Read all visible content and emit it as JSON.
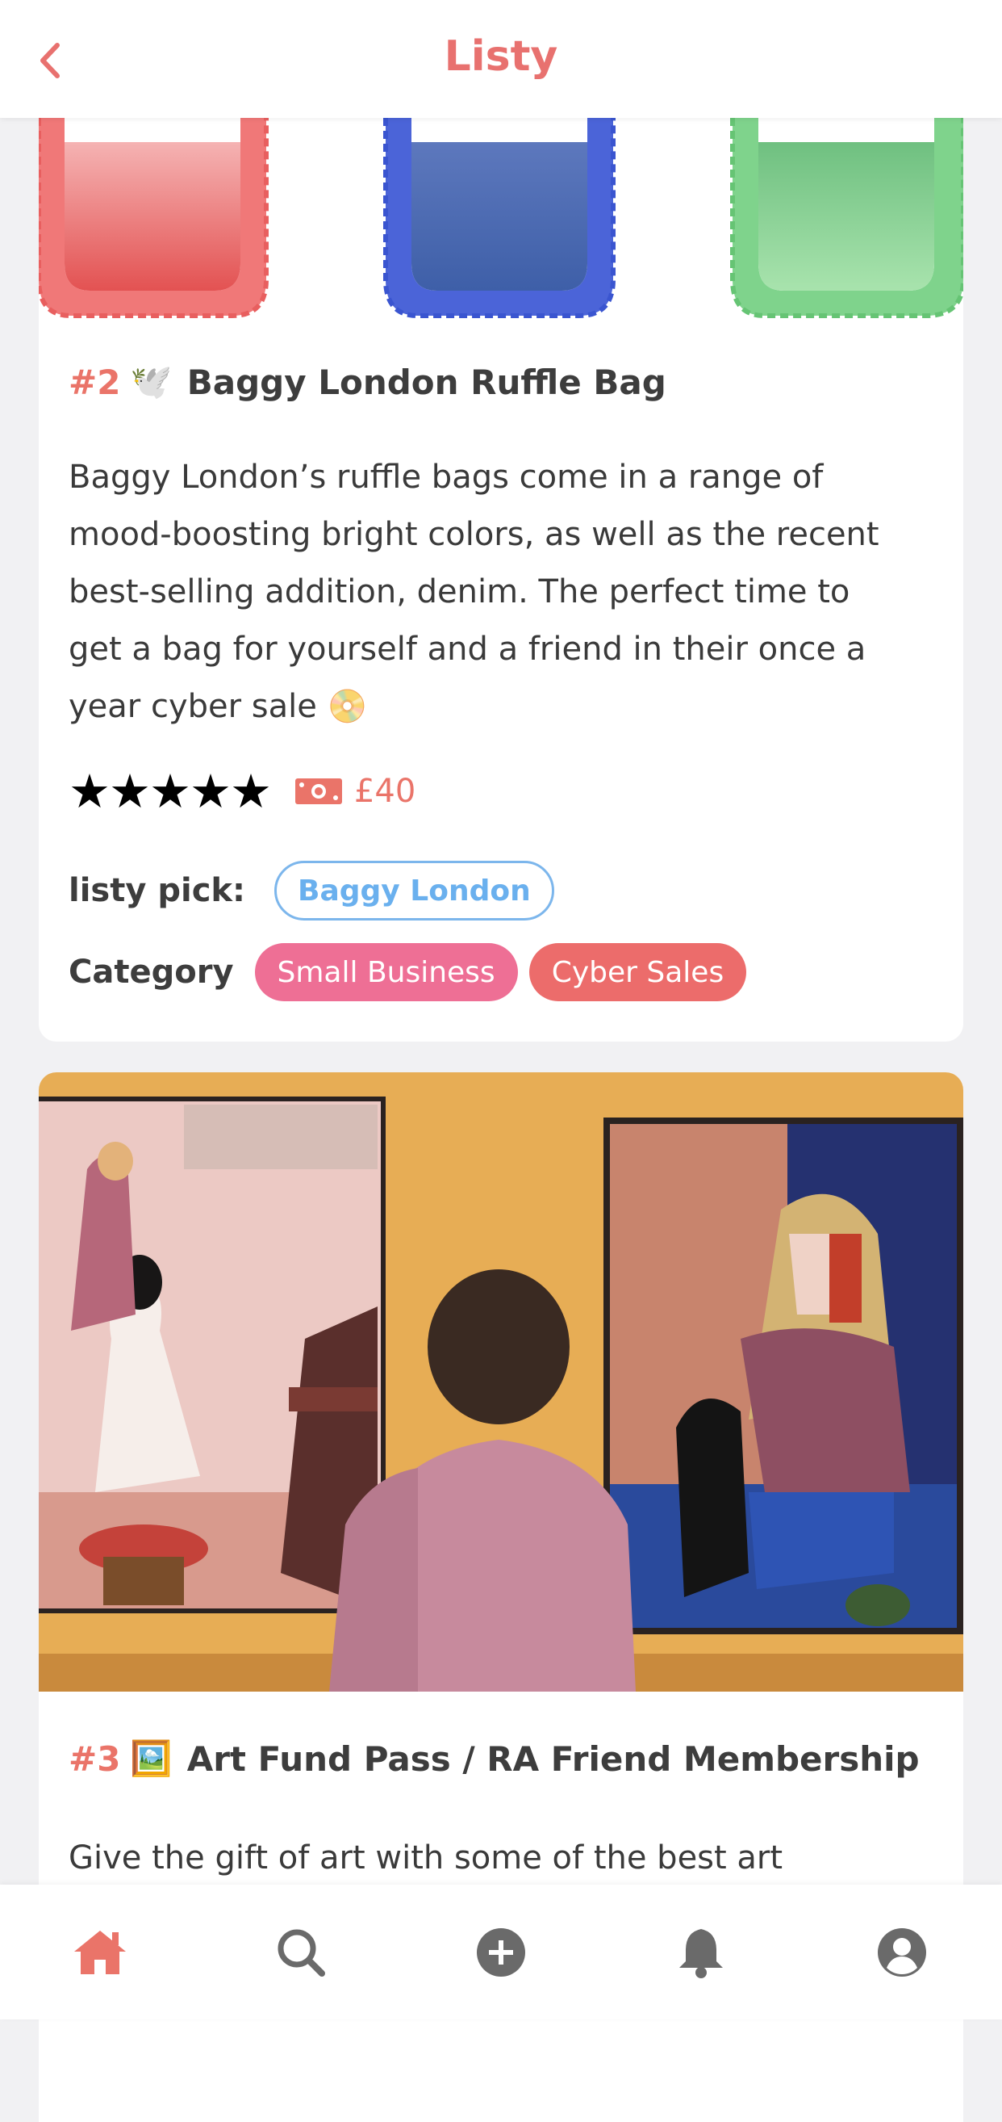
{
  "header": {
    "title": "Listy"
  },
  "items": [
    {
      "rank": "#2",
      "emoji": "🕊️",
      "title": "Baggy London Ruffle Bag",
      "description_lines": [
        "Baggy London’s ruffle bags come in a range of",
        "mood-boosting bright colors, as well as the recent",
        "best-selling addition, denim. The perfect time to",
        "get a bag for yourself and a friend in their once a",
        "year cyber sale 📀"
      ],
      "rating": "★★★★★",
      "price": "£40",
      "pick_label": "listy pick:",
      "pick_value": "Baggy London",
      "category_label": "Category",
      "categories": [
        "Small Business",
        "Cyber Sales"
      ]
    },
    {
      "rank": "#3",
      "emoji": "🖼️",
      "title": "Art Fund Pass / RA Friend Membership",
      "description_lines": [
        "Give the gift of art with some of the best art"
      ]
    }
  ],
  "colors": {
    "accent": "#e8716f",
    "pick": "#6ab0ee",
    "pink": "#ee6f95",
    "coral": "#ec6c6b"
  },
  "nav": [
    {
      "icon": "home-icon",
      "active": true
    },
    {
      "icon": "search-icon"
    },
    {
      "icon": "add-icon"
    },
    {
      "icon": "bell-icon"
    },
    {
      "icon": "profile-icon"
    }
  ]
}
